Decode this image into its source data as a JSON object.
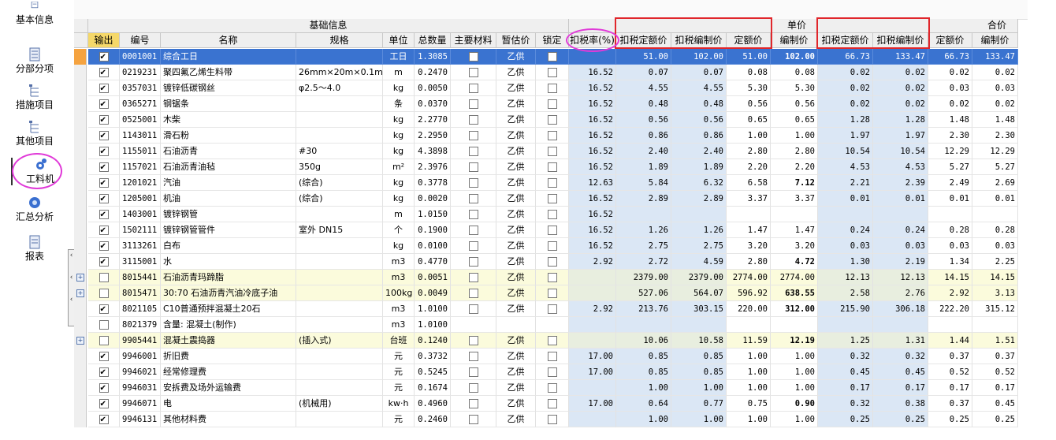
{
  "sidebar": {
    "items": [
      {
        "label": "基本信息",
        "icon": "doc-icon"
      },
      {
        "label": "分部分项",
        "icon": "list-icon"
      },
      {
        "label": "措施项目",
        "icon": "tree-icon"
      },
      {
        "label": "其他项目",
        "icon": "tree-icon"
      },
      {
        "label": "工料机",
        "icon": "gear-icon"
      },
      {
        "label": "汇总分析",
        "icon": "disc-icon"
      },
      {
        "label": "报表",
        "icon": "report-icon"
      }
    ]
  },
  "groups": {
    "basic": "基础信息",
    "unit_price": "单价",
    "total_price": "合价"
  },
  "columns": [
    "输出",
    "编号",
    "名称",
    "规格",
    "单位",
    "总数量",
    "主要材料",
    "暂估价",
    "锁定",
    "扣税率(%)",
    "扣税定额价",
    "扣税编制价",
    "定额价",
    "编制价",
    "扣税定额价",
    "扣税编制价",
    "定额价",
    "编制价"
  ],
  "rows": [
    {
      "exp": "",
      "out": true,
      "code": "0001001",
      "name": "综合工日",
      "spec": "",
      "unit": "工日",
      "qty": "1.3085",
      "main": false,
      "est": "乙供",
      "lock": false,
      "tax": "",
      "ut_q": "51.00",
      "ut_b": "102.00",
      "u_q": "51.00",
      "u_b": "102.00",
      "tt_q": "66.73",
      "tt_b": "133.47",
      "t_q": "66.73",
      "t_b": "133.47",
      "style": "sel",
      "bold_ub": true
    },
    {
      "exp": "",
      "out": true,
      "code": "0219231",
      "name": "聚四氟乙烯生料带",
      "spec": "26mm×20m×0.1mm",
      "unit": "m",
      "qty": "0.2470",
      "main": false,
      "est": "乙供",
      "lock": false,
      "tax": "16.52",
      "ut_q": "0.07",
      "ut_b": "0.07",
      "u_q": "0.08",
      "u_b": "0.08",
      "tt_q": "0.02",
      "tt_b": "0.02",
      "t_q": "0.02",
      "t_b": "0.02",
      "style": ""
    },
    {
      "exp": "",
      "out": true,
      "code": "0357031",
      "name": "镀锌低碳钢丝",
      "spec": "φ2.5～4.0",
      "unit": "kg",
      "qty": "0.0050",
      "main": false,
      "est": "乙供",
      "lock": false,
      "tax": "16.52",
      "ut_q": "4.55",
      "ut_b": "4.55",
      "u_q": "5.30",
      "u_b": "5.30",
      "tt_q": "0.02",
      "tt_b": "0.02",
      "t_q": "0.03",
      "t_b": "0.03",
      "style": ""
    },
    {
      "exp": "",
      "out": true,
      "code": "0365271",
      "name": "钢锯条",
      "spec": "",
      "unit": "条",
      "qty": "0.0370",
      "main": false,
      "est": "乙供",
      "lock": false,
      "tax": "16.52",
      "ut_q": "0.48",
      "ut_b": "0.48",
      "u_q": "0.56",
      "u_b": "0.56",
      "tt_q": "0.02",
      "tt_b": "0.02",
      "t_q": "0.02",
      "t_b": "0.02",
      "style": ""
    },
    {
      "exp": "",
      "out": true,
      "code": "0525001",
      "name": "木柴",
      "spec": "",
      "unit": "kg",
      "qty": "2.2770",
      "main": false,
      "est": "乙供",
      "lock": false,
      "tax": "16.52",
      "ut_q": "0.56",
      "ut_b": "0.56",
      "u_q": "0.65",
      "u_b": "0.65",
      "tt_q": "1.28",
      "tt_b": "1.28",
      "t_q": "1.48",
      "t_b": "1.48",
      "style": ""
    },
    {
      "exp": "",
      "out": true,
      "code": "1143011",
      "name": "滑石粉",
      "spec": "",
      "unit": "kg",
      "qty": "2.2950",
      "main": false,
      "est": "乙供",
      "lock": false,
      "tax": "16.52",
      "ut_q": "0.86",
      "ut_b": "0.86",
      "u_q": "1.00",
      "u_b": "1.00",
      "tt_q": "1.97",
      "tt_b": "1.97",
      "t_q": "2.30",
      "t_b": "2.30",
      "style": ""
    },
    {
      "exp": "",
      "out": true,
      "code": "1155011",
      "name": "石油沥青",
      "spec": "#30",
      "unit": "kg",
      "qty": "4.3898",
      "main": false,
      "est": "乙供",
      "lock": false,
      "tax": "16.52",
      "ut_q": "2.40",
      "ut_b": "2.40",
      "u_q": "2.80",
      "u_b": "2.80",
      "tt_q": "10.54",
      "tt_b": "10.54",
      "t_q": "12.29",
      "t_b": "12.29",
      "style": ""
    },
    {
      "exp": "",
      "out": true,
      "code": "1157021",
      "name": "石油沥青油毡",
      "spec": "350g",
      "unit": "m²",
      "qty": "2.3976",
      "main": false,
      "est": "乙供",
      "lock": false,
      "tax": "16.52",
      "ut_q": "1.89",
      "ut_b": "1.89",
      "u_q": "2.20",
      "u_b": "2.20",
      "tt_q": "4.53",
      "tt_b": "4.53",
      "t_q": "5.27",
      "t_b": "5.27",
      "style": ""
    },
    {
      "exp": "",
      "out": true,
      "code": "1201021",
      "name": "汽油",
      "spec": "(综合)",
      "unit": "kg",
      "qty": "0.3778",
      "main": false,
      "est": "乙供",
      "lock": false,
      "tax": "12.63",
      "ut_q": "5.84",
      "ut_b": "6.32",
      "u_q": "6.58",
      "u_b": "7.12",
      "tt_q": "2.21",
      "tt_b": "2.39",
      "t_q": "2.49",
      "t_b": "2.69",
      "style": "",
      "bold_ub": true
    },
    {
      "exp": "",
      "out": true,
      "code": "1205001",
      "name": "机油",
      "spec": "(综合)",
      "unit": "kg",
      "qty": "0.0020",
      "main": false,
      "est": "乙供",
      "lock": false,
      "tax": "16.52",
      "ut_q": "2.89",
      "ut_b": "2.89",
      "u_q": "3.37",
      "u_b": "3.37",
      "tt_q": "0.01",
      "tt_b": "0.01",
      "t_q": "0.01",
      "t_b": "0.01",
      "style": ""
    },
    {
      "exp": "",
      "out": true,
      "code": "1403001",
      "name": "镀锌钢管",
      "spec": "",
      "unit": "m",
      "qty": "1.0150",
      "main": false,
      "est": "乙供",
      "lock": false,
      "tax": "16.52",
      "ut_q": "",
      "ut_b": "",
      "u_q": "",
      "u_b": "",
      "tt_q": "",
      "tt_b": "",
      "t_q": "",
      "t_b": "",
      "style": ""
    },
    {
      "exp": "",
      "out": true,
      "code": "1502111",
      "name": "镀锌钢管管件",
      "spec": "室外 DN15",
      "unit": "个",
      "qty": "0.1900",
      "main": false,
      "est": "乙供",
      "lock": false,
      "tax": "16.52",
      "ut_q": "1.26",
      "ut_b": "1.26",
      "u_q": "1.47",
      "u_b": "1.47",
      "tt_q": "0.24",
      "tt_b": "0.24",
      "t_q": "0.28",
      "t_b": "0.28",
      "style": ""
    },
    {
      "exp": "",
      "out": true,
      "code": "3113261",
      "name": "白布",
      "spec": "",
      "unit": "kg",
      "qty": "0.0100",
      "main": false,
      "est": "乙供",
      "lock": false,
      "tax": "16.52",
      "ut_q": "2.75",
      "ut_b": "2.75",
      "u_q": "3.20",
      "u_b": "3.20",
      "tt_q": "0.03",
      "tt_b": "0.03",
      "t_q": "0.03",
      "t_b": "0.03",
      "style": ""
    },
    {
      "exp": "",
      "out": true,
      "code": "3115001",
      "name": "水",
      "spec": "",
      "unit": "m3",
      "qty": "0.4770",
      "main": false,
      "est": "乙供",
      "lock": false,
      "tax": "2.92",
      "ut_q": "2.72",
      "ut_b": "4.59",
      "u_q": "2.80",
      "u_b": "4.72",
      "tt_q": "1.30",
      "tt_b": "2.19",
      "t_q": "1.34",
      "t_b": "2.25",
      "style": "",
      "bold_ub": true
    },
    {
      "exp": "+",
      "out": false,
      "code": "8015441",
      "name": "石油沥青玛蹄脂",
      "spec": "",
      "unit": "m3",
      "qty": "0.0051",
      "main": false,
      "est": "乙供",
      "lock": false,
      "tax": "",
      "ut_q": "2379.00",
      "ut_b": "2379.00",
      "u_q": "2774.00",
      "u_b": "2774.00",
      "tt_q": "12.13",
      "tt_b": "12.13",
      "t_q": "14.15",
      "t_b": "14.15",
      "style": "yellow"
    },
    {
      "exp": "+",
      "out": false,
      "code": "8015471",
      "name": "30:70 石油沥青汽油冷底子油",
      "spec": "",
      "unit": "100kg",
      "qty": "0.0049",
      "main": false,
      "est": "乙供",
      "lock": false,
      "tax": "",
      "ut_q": "527.06",
      "ut_b": "564.07",
      "u_q": "596.92",
      "u_b": "638.55",
      "tt_q": "2.58",
      "tt_b": "2.76",
      "t_q": "2.92",
      "t_b": "3.13",
      "style": "yellow",
      "bold_ub": true
    },
    {
      "exp": "",
      "out": true,
      "code": "8021105",
      "name": "C10普通预拌混凝土20石",
      "spec": "",
      "unit": "m3",
      "qty": "1.0100",
      "main": false,
      "est": "乙供",
      "lock": false,
      "tax": "2.92",
      "ut_q": "213.76",
      "ut_b": "303.15",
      "u_q": "220.00",
      "u_b": "312.00",
      "tt_q": "215.90",
      "tt_b": "306.18",
      "t_q": "222.20",
      "t_b": "315.12",
      "style": "",
      "bold_ub": true
    },
    {
      "exp": "",
      "out": false,
      "code": "8021379",
      "name": "含量: 混凝土(制作)",
      "spec": "",
      "unit": "m3",
      "qty": "1.0100",
      "main": null,
      "est": "",
      "lock": null,
      "tax": "",
      "ut_q": "",
      "ut_b": "",
      "u_q": "",
      "u_b": "",
      "tt_q": "",
      "tt_b": "",
      "t_q": "",
      "t_b": "",
      "style": ""
    },
    {
      "exp": "+",
      "out": false,
      "code": "9905441",
      "name": "混凝土震捣器",
      "spec": "(插入式)",
      "unit": "台班",
      "qty": "0.1240",
      "main": false,
      "est": "乙供",
      "lock": false,
      "tax": "",
      "ut_q": "10.06",
      "ut_b": "10.58",
      "u_q": "11.59",
      "u_b": "12.19",
      "tt_q": "1.25",
      "tt_b": "1.31",
      "t_q": "1.44",
      "t_b": "1.51",
      "style": "yellow",
      "bold_ub": true
    },
    {
      "exp": "",
      "out": true,
      "code": "9946001",
      "name": "折旧费",
      "spec": "",
      "unit": "元",
      "qty": "0.3732",
      "main": false,
      "est": "乙供",
      "lock": false,
      "tax": "17.00",
      "ut_q": "0.85",
      "ut_b": "0.85",
      "u_q": "1.00",
      "u_b": "1.00",
      "tt_q": "0.32",
      "tt_b": "0.32",
      "t_q": "0.37",
      "t_b": "0.37",
      "style": ""
    },
    {
      "exp": "",
      "out": true,
      "code": "9946021",
      "name": "经常修理费",
      "spec": "",
      "unit": "元",
      "qty": "0.5245",
      "main": false,
      "est": "乙供",
      "lock": false,
      "tax": "17.00",
      "ut_q": "0.85",
      "ut_b": "0.85",
      "u_q": "1.00",
      "u_b": "1.00",
      "tt_q": "0.45",
      "tt_b": "0.45",
      "t_q": "0.52",
      "t_b": "0.52",
      "style": ""
    },
    {
      "exp": "",
      "out": true,
      "code": "9946031",
      "name": "安拆费及场外运输费",
      "spec": "",
      "unit": "元",
      "qty": "0.1674",
      "main": false,
      "est": "乙供",
      "lock": false,
      "tax": "",
      "ut_q": "1.00",
      "ut_b": "1.00",
      "u_q": "1.00",
      "u_b": "1.00",
      "tt_q": "0.17",
      "tt_b": "0.17",
      "t_q": "0.17",
      "t_b": "0.17",
      "style": ""
    },
    {
      "exp": "",
      "out": true,
      "code": "9946071",
      "name": "电",
      "spec": "(机械用)",
      "unit": "kw·h",
      "qty": "0.4960",
      "main": false,
      "est": "乙供",
      "lock": false,
      "tax": "17.00",
      "ut_q": "0.64",
      "ut_b": "0.77",
      "u_q": "0.75",
      "u_b": "0.90",
      "tt_q": "0.32",
      "tt_b": "0.38",
      "t_q": "0.37",
      "t_b": "0.45",
      "style": "",
      "bold_ub": true
    },
    {
      "exp": "",
      "out": true,
      "code": "9946131",
      "name": "其他材料费",
      "spec": "",
      "unit": "元",
      "qty": "0.2460",
      "main": false,
      "est": "乙供",
      "lock": false,
      "tax": "",
      "ut_q": "1.00",
      "ut_b": "1.00",
      "u_q": "1.00",
      "u_b": "1.00",
      "tt_q": "0.25",
      "tt_b": "0.25",
      "t_q": "0.25",
      "t_b": "0.25",
      "style": ""
    }
  ],
  "colors": {
    "selected_row": "#3a73d0",
    "blue_col": "#dbe7f5",
    "yellow_row": "#fbfbdc",
    "highlight_box": "#e0262b",
    "highlight_ellipse": "#e03ad8"
  }
}
